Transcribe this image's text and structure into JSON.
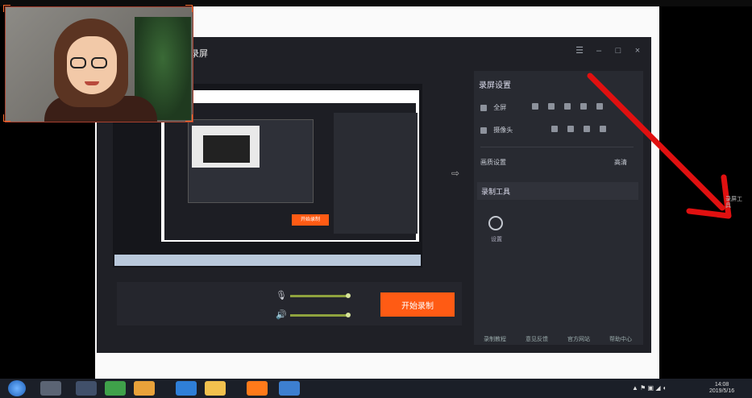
{
  "app": {
    "title": "录屏",
    "window_controls": [
      "☰",
      "–",
      "□",
      "×"
    ]
  },
  "right_panel": {
    "header": "录屏设置",
    "rows": [
      {
        "label": "全屏",
        "icon": "monitor-icon"
      },
      {
        "label": "摄像头",
        "icon": "camera-icon"
      },
      {
        "label": "",
        "icon": "divider"
      },
      {
        "label": "画质设置",
        "value": "高清"
      }
    ],
    "section": "录制工具",
    "gear_label": "设置",
    "footer_links": [
      "录制教程",
      "意见反馈",
      "官方网站",
      "帮助中心"
    ]
  },
  "controls": {
    "mic_level": 0.95,
    "speaker_level": 0.95,
    "start_label": "开始录制"
  },
  "preview": {
    "button_label": "开始录制"
  },
  "desktop": {
    "side_text": "录屏工具"
  },
  "taskbar": {
    "clock_time": "14:08",
    "clock_date": "2019/5/16"
  },
  "colors": {
    "accent": "#ff5b14",
    "arrow": "#e01010",
    "panel": "#282a31"
  }
}
